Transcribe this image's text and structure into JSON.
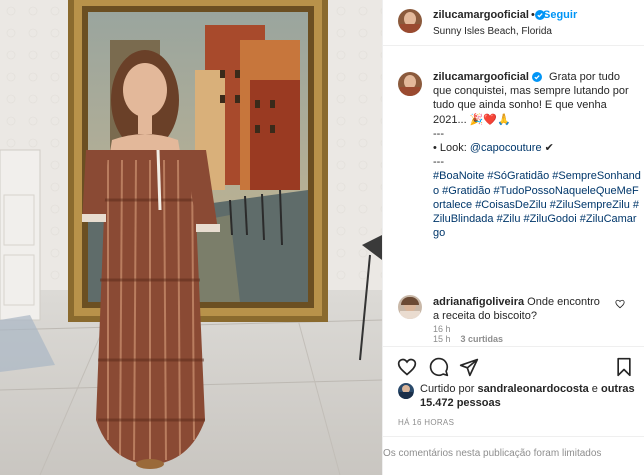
{
  "post": {
    "username": "zilucamargooficial",
    "dot": "•",
    "follow_label": "Seguir",
    "location": "Sunny Isles Beach, Florida"
  },
  "caption": {
    "username": "zilucamargooficial",
    "line1": "Grata por tudo que conquistei, mas sempre lutando por tudo que ainda sonho! E que venha 2021... 🎉❤️🙏",
    "sep1": "---",
    "look_prefix": "• Look: ",
    "look_mention": "@capocouture",
    "look_suffix": " ✔",
    "sep2": "---",
    "hashtags": "#BoaNoite #SóGratidão #SempreSonhando #Gratidão #TudoPossoNaqueleQueMeFortalece #CoisasDeZilu #ZiluSempreZilu #ZiluBlindada #Zilu #ZiluGodoi #ZiluCamargo",
    "time": "16 h"
  },
  "comment": {
    "username": "adrianafigoliveira",
    "text": "Onde encontro a receita do biscoito?",
    "time": "15 h",
    "likes": "3 curtidas"
  },
  "actions": {
    "like_icon": "heart-outline-icon",
    "comment_icon": "comment-bubble-icon",
    "share_icon": "paper-plane-icon",
    "save_icon": "bookmark-icon"
  },
  "likes": {
    "prefix": "Curtido por ",
    "user": "sandraleonardocosta",
    "middle": " e ",
    "others": "outras 15.472 pessoas"
  },
  "timestamp": "HÁ 16 HORAS",
  "comments_limited": "Os comentários nesta publicação foram limitados",
  "colors": {
    "accent": "#0095f6",
    "link": "#00376b",
    "muted": "#8e8e8e",
    "text": "#262626"
  }
}
